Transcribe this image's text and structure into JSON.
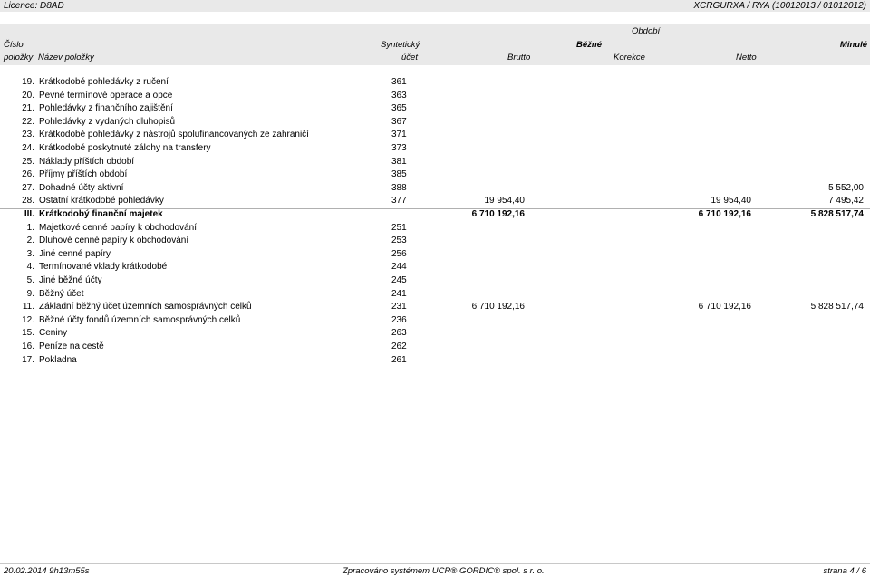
{
  "top": {
    "license": "Licence: D8AD",
    "code": "XCRGURXA / RYA  (10012013 / 01012012)"
  },
  "header": {
    "obdobi": "Období",
    "cislo": "Číslo",
    "polozky": "položky",
    "nazev": "Název položky",
    "synteticky": "Syntetický",
    "ucet": "účet",
    "bezne": "Běžné",
    "minule": "Minulé",
    "brutto": "Brutto",
    "korekce": "Korekce",
    "netto": "Netto"
  },
  "rows": [
    {
      "num": "19.",
      "name": "Krátkodobé pohledávky z ručení",
      "acct": "361",
      "brutto": "",
      "netto": "",
      "minule": "",
      "bold": false
    },
    {
      "num": "20.",
      "name": "Pevné termínové operace a opce",
      "acct": "363",
      "brutto": "",
      "netto": "",
      "minule": "",
      "bold": false
    },
    {
      "num": "21.",
      "name": "Pohledávky z finančního zajištění",
      "acct": "365",
      "brutto": "",
      "netto": "",
      "minule": "",
      "bold": false
    },
    {
      "num": "22.",
      "name": "Pohledávky z vydaných dluhopisů",
      "acct": "367",
      "brutto": "",
      "netto": "",
      "minule": "",
      "bold": false
    },
    {
      "num": "23.",
      "name": "Krátkodobé pohledávky z nástrojů spolufinancovaných ze zahraničí",
      "acct": "371",
      "brutto": "",
      "netto": "",
      "minule": "",
      "bold": false
    },
    {
      "num": "24.",
      "name": "Krátkodobé poskytnuté zálohy na transfery",
      "acct": "373",
      "brutto": "",
      "netto": "",
      "minule": "",
      "bold": false
    },
    {
      "num": "25.",
      "name": "Náklady příštích období",
      "acct": "381",
      "brutto": "",
      "netto": "",
      "minule": "",
      "bold": false
    },
    {
      "num": "26.",
      "name": "Příjmy příštích období",
      "acct": "385",
      "brutto": "",
      "netto": "",
      "minule": "",
      "bold": false
    },
    {
      "num": "27.",
      "name": "Dohadné účty aktivní",
      "acct": "388",
      "brutto": "",
      "netto": "",
      "minule": "5 552,00",
      "bold": false
    },
    {
      "num": "28.",
      "name": "Ostatní krátkodobé pohledávky",
      "acct": "377",
      "brutto": "19 954,40",
      "netto": "19 954,40",
      "minule": "7 495,42",
      "bold": false
    },
    {
      "num": "III.",
      "name": "Krátkodobý finanční majetek",
      "acct": "",
      "brutto": "6 710 192,16",
      "netto": "6 710 192,16",
      "minule": "5 828 517,74",
      "bold": true
    },
    {
      "num": "1.",
      "name": "Majetkové cenné papíry k obchodování",
      "acct": "251",
      "brutto": "",
      "netto": "",
      "minule": "",
      "bold": false
    },
    {
      "num": "2.",
      "name": "Dluhové cenné papíry k obchodování",
      "acct": "253",
      "brutto": "",
      "netto": "",
      "minule": "",
      "bold": false
    },
    {
      "num": "3.",
      "name": "Jiné cenné papíry",
      "acct": "256",
      "brutto": "",
      "netto": "",
      "minule": "",
      "bold": false
    },
    {
      "num": "4.",
      "name": "Termínované vklady krátkodobé",
      "acct": "244",
      "brutto": "",
      "netto": "",
      "minule": "",
      "bold": false
    },
    {
      "num": "5.",
      "name": "Jiné běžné účty",
      "acct": "245",
      "brutto": "",
      "netto": "",
      "minule": "",
      "bold": false
    },
    {
      "num": "9.",
      "name": "Běžný účet",
      "acct": "241",
      "brutto": "",
      "netto": "",
      "minule": "",
      "bold": false
    },
    {
      "num": "11.",
      "name": "Základní běžný účet územních samosprávných celků",
      "acct": "231",
      "brutto": "6 710 192,16",
      "netto": "6 710 192,16",
      "minule": "5 828 517,74",
      "bold": false
    },
    {
      "num": "12.",
      "name": "Běžné účty fondů územních samosprávných celků",
      "acct": "236",
      "brutto": "",
      "netto": "",
      "minule": "",
      "bold": false
    },
    {
      "num": "15.",
      "name": "Ceniny",
      "acct": "263",
      "brutto": "",
      "netto": "",
      "minule": "",
      "bold": false
    },
    {
      "num": "16.",
      "name": "Peníze na cestě",
      "acct": "262",
      "brutto": "",
      "netto": "",
      "minule": "",
      "bold": false
    },
    {
      "num": "17.",
      "name": "Pokladna",
      "acct": "261",
      "brutto": "",
      "netto": "",
      "minule": "",
      "bold": false
    }
  ],
  "footer": {
    "date": "20.02.2014 9h13m55s",
    "system": "Zpracováno systémem UCR® GORDIC® spol. s  r. o.",
    "page": "strana 4 / 6"
  }
}
